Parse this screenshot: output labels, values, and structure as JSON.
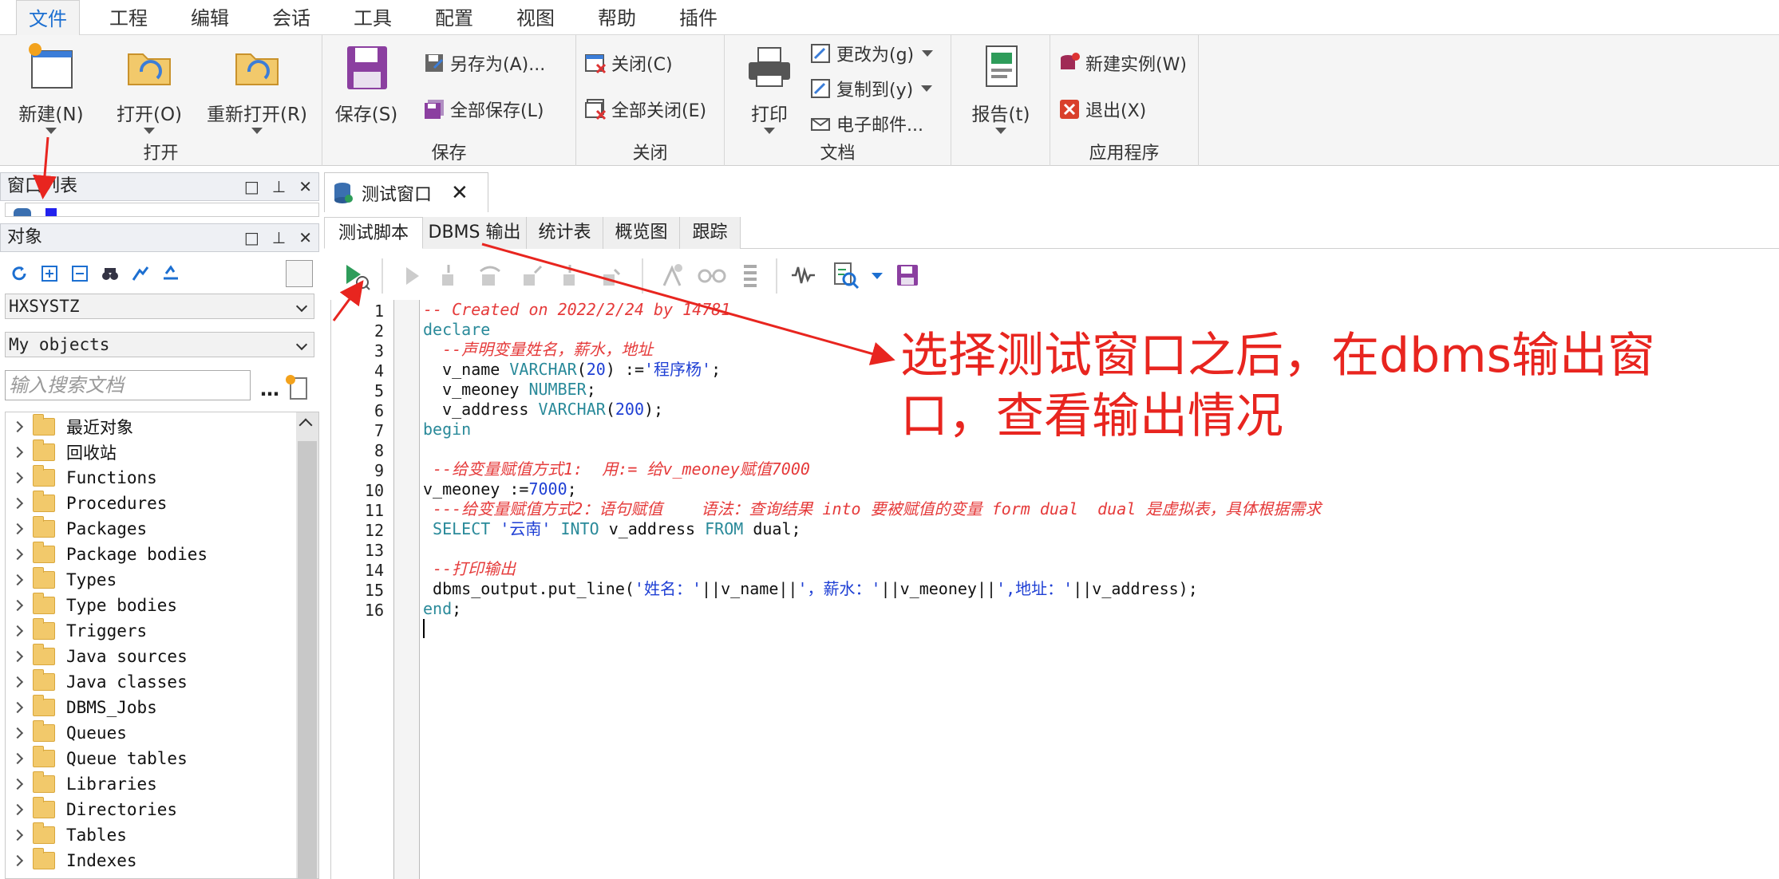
{
  "menubar": {
    "items": [
      "文件",
      "工程",
      "编辑",
      "会话",
      "工具",
      "配置",
      "视图",
      "帮助",
      "插件"
    ]
  },
  "ribbon": {
    "groups": {
      "open": "打开",
      "save": "保存",
      "close": "关闭",
      "document": "文档",
      "app": "应用程序"
    },
    "new_label": "新建(N)",
    "open_label": "打开(O)",
    "reopen_label": "重新打开(R)",
    "save_label": "保存(S)",
    "saveas_label": "另存为(A)...",
    "saveall_label": "全部保存(L)",
    "close_label": "关闭(C)",
    "closeall_label": "全部关闭(E)",
    "print_label": "打印",
    "changeto_label": "更改为(g)",
    "copyto_label": "复制到(y)",
    "email_label": "电子邮件...",
    "report_label": "报告(t)",
    "newinstance_label": "新建实例(W)",
    "exit_label": "退出(X)"
  },
  "window_list": {
    "title": "窗口列表"
  },
  "objects": {
    "title": "对象",
    "schema": "HXSYSTZ",
    "filter": "My objects",
    "search_placeholder": "输入搜索文档",
    "tree": [
      "最近对象",
      "回收站",
      "Functions",
      "Procedures",
      "Packages",
      "Package bodies",
      "Types",
      "Type bodies",
      "Triggers",
      "Java sources",
      "Java classes",
      "DBMS_Jobs",
      "Queues",
      "Queue tables",
      "Libraries",
      "Directories",
      "Tables",
      "Indexes"
    ]
  },
  "document": {
    "tab_title": "测试窗口",
    "subtabs": [
      "测试脚本",
      "DBMS 输出",
      "统计表",
      "概览图",
      "跟踪"
    ]
  },
  "editor": {
    "line_numbers": [
      "1",
      "2",
      "3",
      "4",
      "5",
      "6",
      "7",
      "8",
      "9",
      "10",
      "11",
      "12",
      "13",
      "14",
      "15",
      "16"
    ]
  },
  "annotation": {
    "text": "选择测试窗口之后，在dbms输出窗口，查看输出情况"
  },
  "colors": {
    "accent": "#1c6fd1",
    "annotation_red": "#e8251f",
    "comment_red": "#e53a3a",
    "keyword_teal": "#2a8a9a",
    "string_blue": "#1e3fd4"
  }
}
